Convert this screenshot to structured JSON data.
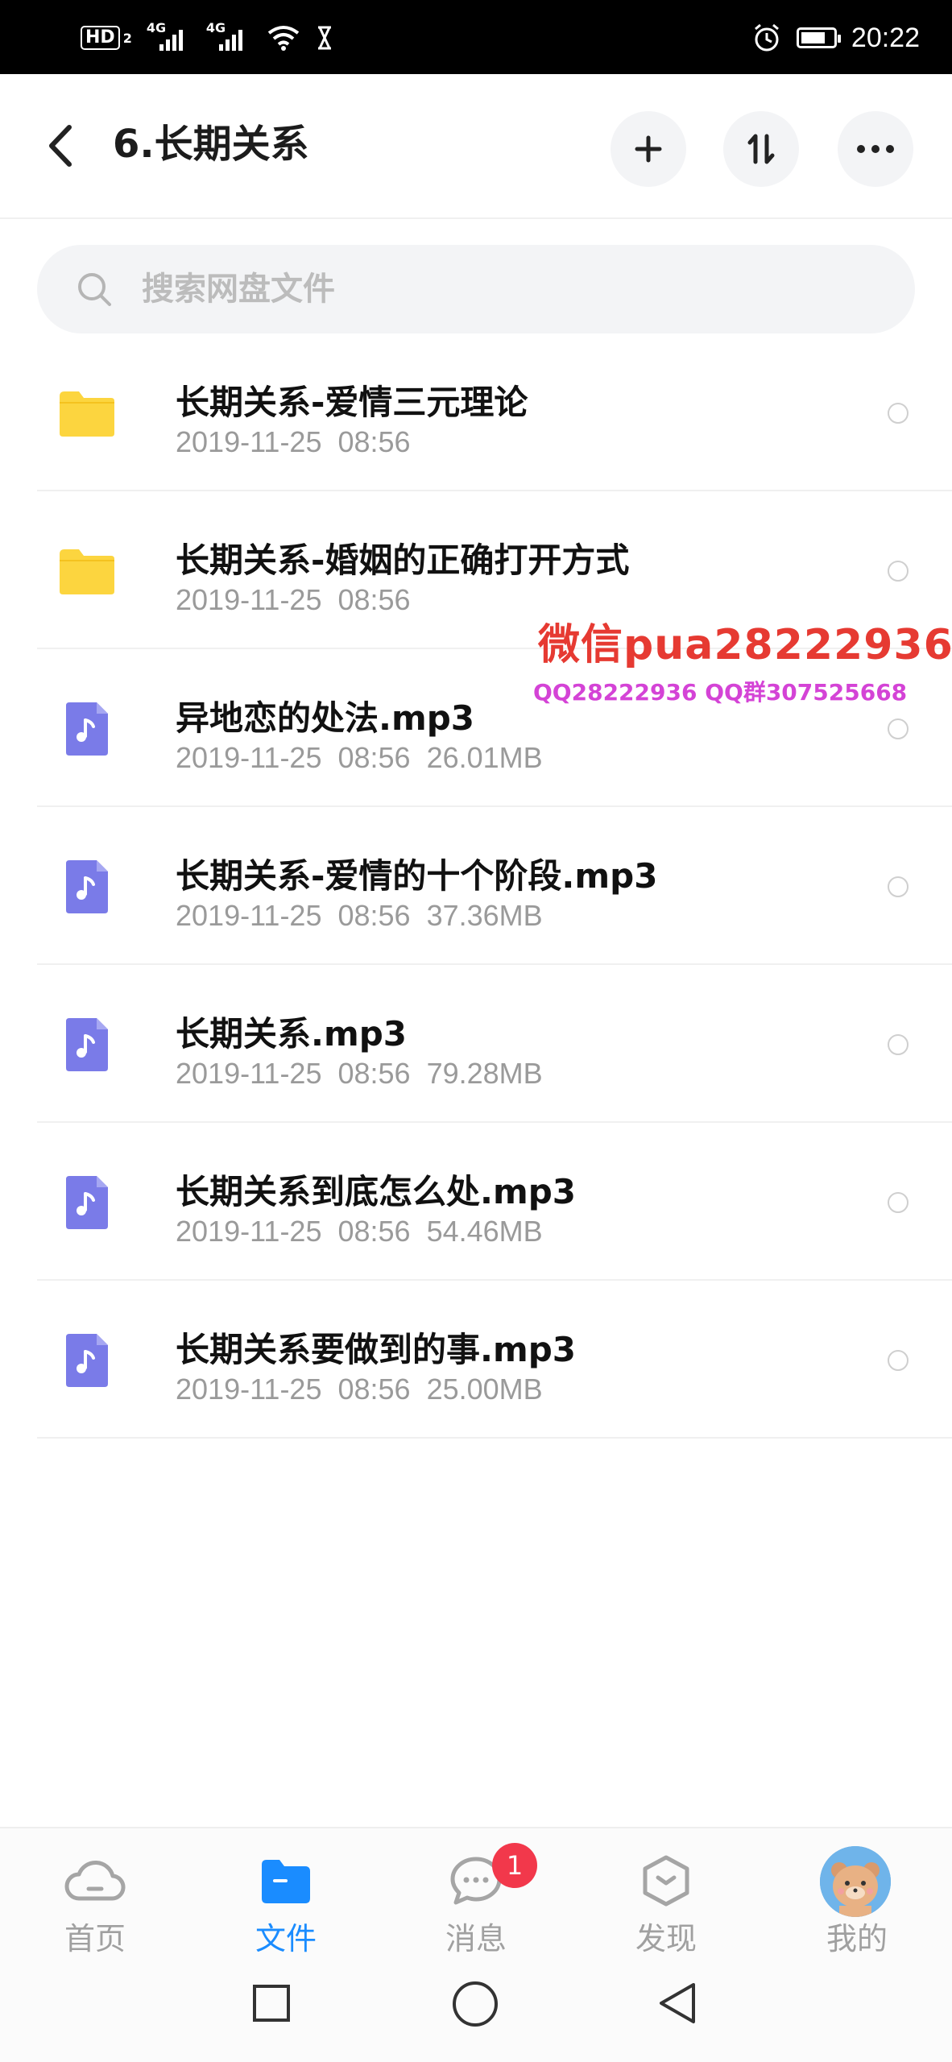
{
  "status_bar": {
    "hd": "HD",
    "sim1": "2",
    "net1": "4G",
    "net2": "4G",
    "time": "20:22"
  },
  "header": {
    "title": "6.长期关系",
    "icons": [
      "back-arrow-icon",
      "plus-icon",
      "sort-icon",
      "more-icon"
    ]
  },
  "search": {
    "placeholder": "搜索网盘文件"
  },
  "files": [
    {
      "type": "folder",
      "name": "长期关系-爱情三元理论",
      "date": "2019-11-25",
      "time": "08:56",
      "size": ""
    },
    {
      "type": "folder",
      "name": "长期关系-婚姻的正确打开方式",
      "date": "2019-11-25",
      "time": "08:56",
      "size": ""
    },
    {
      "type": "audio",
      "name": "异地恋的处法.mp3",
      "date": "2019-11-25",
      "time": "08:56",
      "size": "26.01MB"
    },
    {
      "type": "audio",
      "name": "长期关系-爱情的十个阶段.mp3",
      "date": "2019-11-25",
      "time": "08:56",
      "size": "37.36MB"
    },
    {
      "type": "audio",
      "name": "长期关系.mp3",
      "date": "2019-11-25",
      "time": "08:56",
      "size": "79.28MB"
    },
    {
      "type": "audio",
      "name": "长期关系到底怎么处.mp3",
      "date": "2019-11-25",
      "time": "08:56",
      "size": "54.46MB"
    },
    {
      "type": "audio",
      "name": "长期关系要做到的事.mp3",
      "date": "2019-11-25",
      "time": "08:56",
      "size": "25.00MB"
    }
  ],
  "watermark": {
    "line1": "微信pua28222936",
    "line2": "QQ28222936 QQ群307525668"
  },
  "tabs": [
    {
      "label": "首页",
      "icon": "cloud-icon",
      "active": false
    },
    {
      "label": "文件",
      "icon": "folder-icon",
      "active": true
    },
    {
      "label": "消息",
      "icon": "chat-icon",
      "active": false,
      "badge": "1"
    },
    {
      "label": "发现",
      "icon": "discover-icon",
      "active": false
    },
    {
      "label": "我的",
      "icon": "avatar-icon",
      "active": false
    }
  ],
  "colors": {
    "accent": "#1a8cff",
    "folder": "#fcd53f",
    "audio": "#7a7be8",
    "badge": "#f2384b",
    "watermark_red": "#e63a32",
    "watermark_pink": "#d443d6"
  },
  "battery_level": 0.75
}
